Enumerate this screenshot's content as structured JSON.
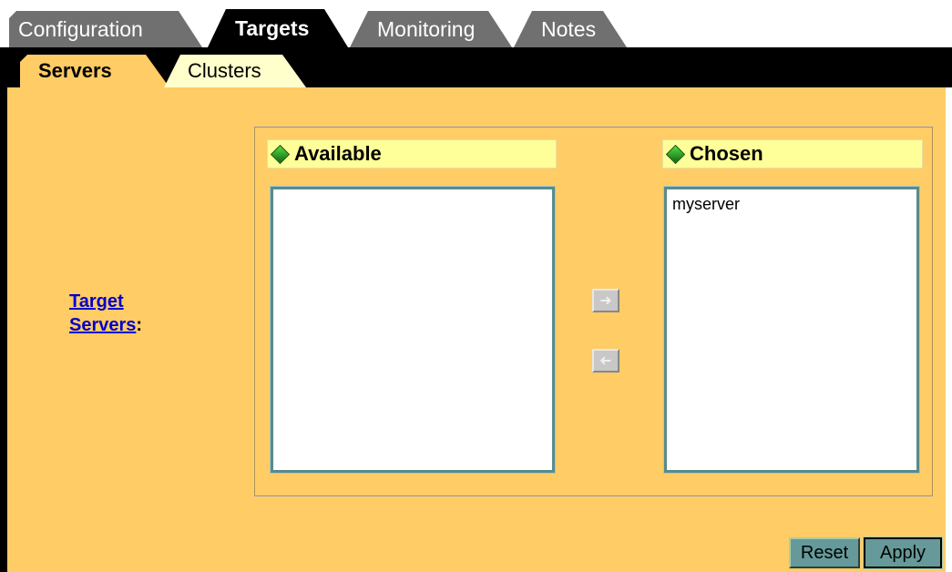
{
  "top_tabs": [
    {
      "label": "Configuration",
      "active": false
    },
    {
      "label": "Targets",
      "active": true
    },
    {
      "label": "Monitoring",
      "active": false
    },
    {
      "label": "Notes",
      "active": false
    }
  ],
  "sub_tabs": [
    {
      "label": "Servers",
      "active": true
    },
    {
      "label": "Clusters",
      "active": false
    }
  ],
  "target_field": {
    "link_line1": "Target",
    "link_line2": "Servers",
    "suffix": ":"
  },
  "picker": {
    "available_label": "Available",
    "chosen_label": "Chosen",
    "available_items": [],
    "chosen_items": [
      "myserver"
    ],
    "move_right_icon": "arrow-right-icon",
    "move_left_icon": "arrow-left-icon"
  },
  "buttons": {
    "reset": "Reset",
    "apply": "Apply"
  },
  "colors": {
    "panel": "#ffcc66",
    "header": "#ffff99",
    "active_tab": "#000000",
    "inactive_tab": "#707070",
    "button": "#669999"
  }
}
